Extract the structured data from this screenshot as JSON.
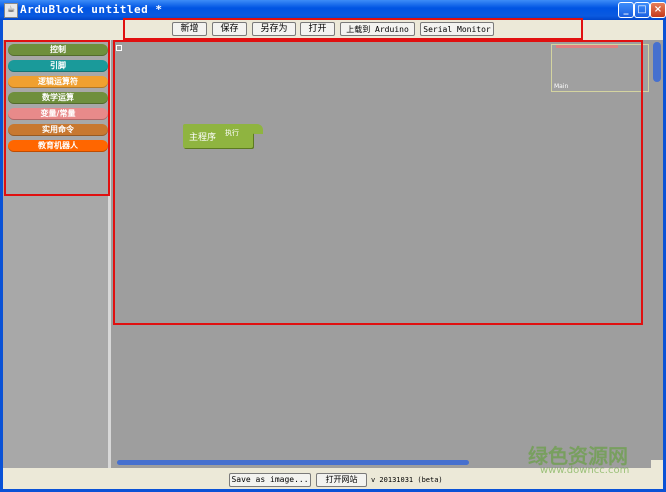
{
  "window": {
    "title": "ArduBlock untitled *",
    "minimize_label": "_",
    "maximize_label": "□",
    "close_label": "×"
  },
  "toolbar": {
    "new_label": "新增",
    "save_label": "保存",
    "save_as_label": "另存为",
    "open_label": "打开",
    "upload_label": "上载到 Arduino",
    "serial_monitor_label": "Serial Monitor"
  },
  "sidebar": {
    "categories": [
      {
        "label": "控制",
        "color": "#6f8f3d"
      },
      {
        "label": "引脚",
        "color": "#1a9a9a"
      },
      {
        "label": "逻辑运算符",
        "color": "#f0a030"
      },
      {
        "label": "数学运算",
        "color": "#6f8f3d"
      },
      {
        "label": "变量/常量",
        "color": "#e88a8a"
      },
      {
        "label": "实用命令",
        "color": "#c87830"
      },
      {
        "label": "教育机器人",
        "color": "#ff6600"
      }
    ]
  },
  "canvas": {
    "main_block": {
      "label": "主程序",
      "exec_label": "执行",
      "color": "#8fb440"
    },
    "minimap_label": "Main"
  },
  "bottom": {
    "save_image_label": "Save as image...",
    "open_site_label": "打开网站",
    "version": "v 20131031 (beta)"
  },
  "watermark": {
    "line1": "绿色资源网",
    "line2": "www.downcc.com"
  },
  "colors": {
    "highlight_box": "#e01010",
    "canvas_bg": "#9e9e9e",
    "scrollbar_thumb": "#4670cf"
  }
}
